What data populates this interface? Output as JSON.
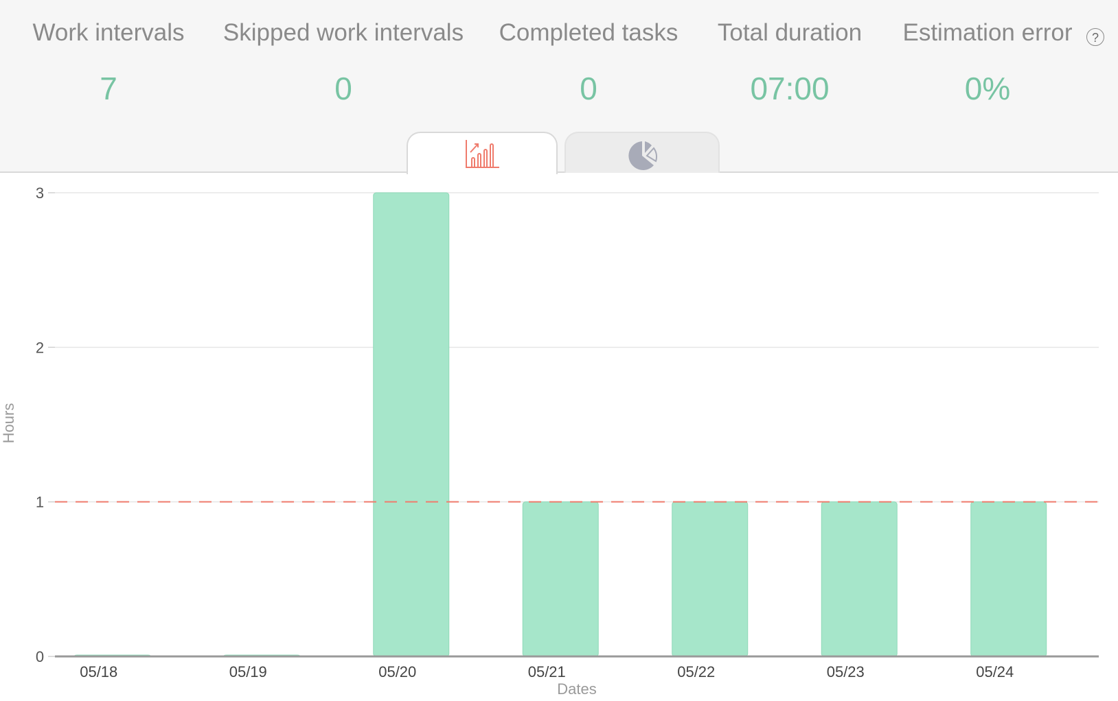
{
  "stats": [
    {
      "label": "Work intervals",
      "value": "7"
    },
    {
      "label": "Skipped work intervals",
      "value": "0"
    },
    {
      "label": "Completed tasks",
      "value": "0"
    },
    {
      "label": "Total duration",
      "value": "07:00"
    },
    {
      "label": "Estimation error",
      "value": "0%"
    }
  ],
  "help_icon": "?",
  "tabs": [
    {
      "icon": "bar-chart-icon",
      "active": true
    },
    {
      "icon": "pie-chart-icon",
      "active": false
    }
  ],
  "colors": {
    "accent_value": "#78c4a3",
    "bar_fill": "#a6e6ca",
    "bar_stroke": "#8fd9b8",
    "goal_line": "#ef7b6c",
    "active_tab_icon": "#ef7b6c",
    "inactive_tab_icon": "#a8abb8"
  },
  "chart_data": {
    "type": "bar",
    "categories": [
      "05/18",
      "05/19",
      "05/20",
      "05/21",
      "05/22",
      "05/23",
      "05/24"
    ],
    "values": [
      0,
      0,
      3,
      1,
      1,
      1,
      1
    ],
    "xlabel": "Dates",
    "ylabel": "Hours",
    "ylim": [
      0,
      3
    ],
    "yticks": [
      0,
      1,
      2,
      3
    ],
    "goal_line": 1,
    "grid": true
  }
}
